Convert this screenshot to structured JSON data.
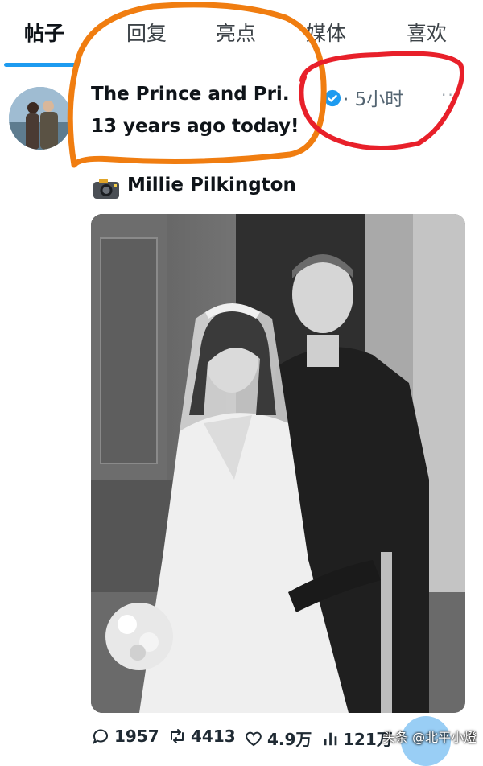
{
  "tabs": [
    {
      "label": "帖子",
      "active": true
    },
    {
      "label": "回复"
    },
    {
      "label": "亮点"
    },
    {
      "label": "媒体"
    },
    {
      "label": "喜欢"
    }
  ],
  "post": {
    "author": "The Prince and Pri.",
    "meta": "· 5小时",
    "more": "···",
    "text": "13 years ago today!",
    "photo_credit": "Millie Pilkington",
    "credit_icon": "camera-emoji",
    "image_alt": "Black-and-white wedding portrait of a bride in a lace gown and tiara beside a groom in military uniform"
  },
  "actions": {
    "replies": "1957",
    "reposts": "4413",
    "likes": "4.9万",
    "views": "121万"
  },
  "watermark": "头条 @北平小燈",
  "colors": {
    "accent": "#1d9bf0",
    "orange_annotation": "#f07d10",
    "red_annotation": "#e8202a"
  }
}
